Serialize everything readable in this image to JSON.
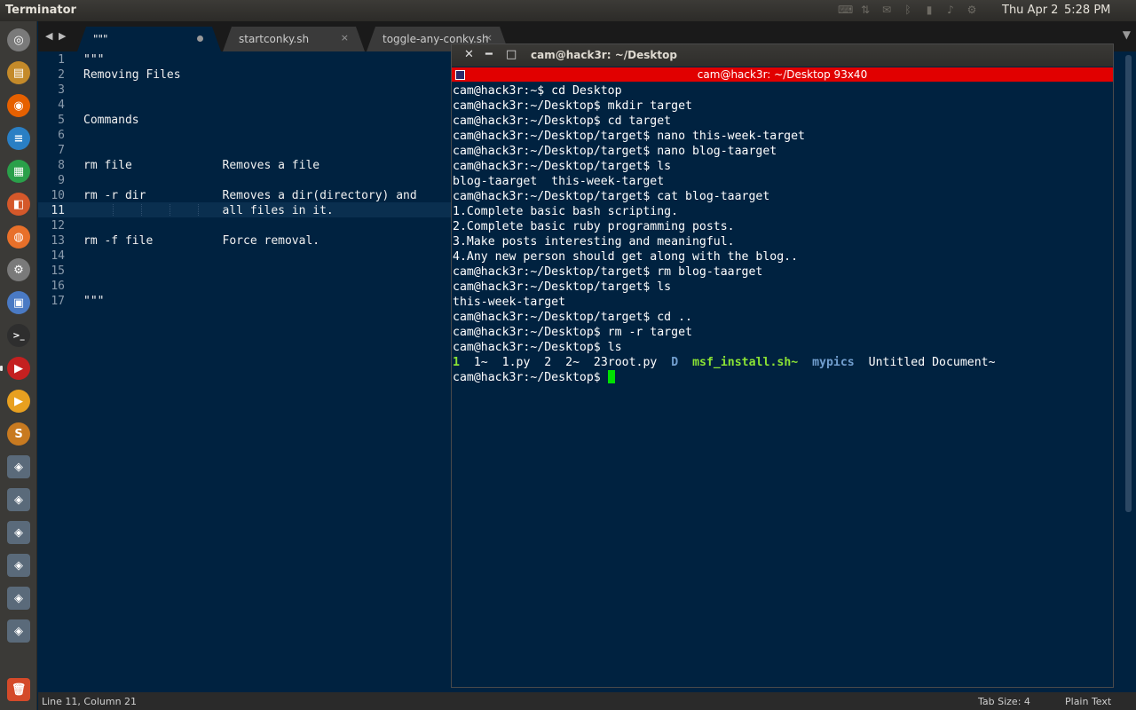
{
  "top_panel": {
    "app_title": "Terminator",
    "date": "Thu Apr  2",
    "time": "5:28 PM",
    "indicators": [
      "keyboard-icon",
      "network-icon",
      "mail-icon",
      "bluetooth-icon",
      "battery-icon",
      "volume-icon",
      "settings-icon"
    ]
  },
  "launcher": {
    "items": [
      {
        "name": "dash-icon",
        "color": "#7a7a7a"
      },
      {
        "name": "files-icon",
        "color": "#c48a2a"
      },
      {
        "name": "firefox-icon",
        "color": "#e66000"
      },
      {
        "name": "writer-icon",
        "color": "#2a7fc4"
      },
      {
        "name": "calc-icon",
        "color": "#2aa04a"
      },
      {
        "name": "impress-icon",
        "color": "#d4582a"
      },
      {
        "name": "software-center-icon",
        "color": "#e8702a"
      },
      {
        "name": "settings-icon",
        "color": "#7a7a7a"
      },
      {
        "name": "workspace-icon",
        "color": "#4a7ac4"
      },
      {
        "name": "terminal-icon",
        "color": "#2e2e2e"
      },
      {
        "name": "terminator-icon",
        "color": "#c42020"
      },
      {
        "name": "media-player-icon",
        "color": "#e8a020"
      },
      {
        "name": "sublime-icon",
        "color": "#c87a20"
      },
      {
        "name": "disk-icon",
        "color": "#5a6a7a"
      },
      {
        "name": "disk-icon",
        "color": "#5a6a7a"
      },
      {
        "name": "disk-icon",
        "color": "#5a6a7a"
      },
      {
        "name": "disk-icon",
        "color": "#5a6a7a"
      },
      {
        "name": "disk-icon",
        "color": "#5a6a7a"
      },
      {
        "name": "disk-icon",
        "color": "#5a6a7a"
      },
      {
        "name": "trash-icon",
        "color": "#d44a2a"
      }
    ]
  },
  "editor": {
    "tabs": [
      {
        "label": "\"\"\"",
        "modified": true
      },
      {
        "label": "startconky.sh",
        "close": "×"
      },
      {
        "label": "toggle-any-conky.sh",
        "close": "×"
      }
    ],
    "lines": [
      {
        "n": "1",
        "text": "\"\"\""
      },
      {
        "n": "2",
        "text": "Removing Files"
      },
      {
        "n": "3",
        "text": ""
      },
      {
        "n": "4",
        "text": ""
      },
      {
        "n": "5",
        "text": "Commands"
      },
      {
        "n": "6",
        "text": ""
      },
      {
        "n": "7",
        "text": ""
      },
      {
        "n": "8",
        "text": "rm file             Removes a file"
      },
      {
        "n": "9",
        "text": ""
      },
      {
        "n": "10",
        "text": "rm -r dir           Removes a dir(directory) and"
      },
      {
        "n": "11",
        "text": "                    all files in it."
      },
      {
        "n": "12",
        "text": ""
      },
      {
        "n": "13",
        "text": "rm -f file          Force removal."
      },
      {
        "n": "14",
        "text": ""
      },
      {
        "n": "15",
        "text": ""
      },
      {
        "n": "16",
        "text": ""
      },
      {
        "n": "17",
        "text": "\"\"\""
      }
    ],
    "status": {
      "position": "Line 11, Column 21",
      "tab_size": "Tab Size: 4",
      "syntax": "Plain Text"
    }
  },
  "terminal": {
    "window_title": "cam@hack3r: ~/Desktop",
    "header_title": "cam@hack3r: ~/Desktop 93x40",
    "lines": [
      "cam@hack3r:~$ cd Desktop",
      "cam@hack3r:~/Desktop$ mkdir target",
      "cam@hack3r:~/Desktop$ cd target",
      "cam@hack3r:~/Desktop/target$ nano this-week-target",
      "cam@hack3r:~/Desktop/target$ nano blog-taarget",
      "cam@hack3r:~/Desktop/target$ ls",
      "blog-taarget  this-week-target",
      "cam@hack3r:~/Desktop/target$ cat blog-taarget",
      "1.Complete basic bash scripting.",
      "2.Complete basic ruby programming posts.",
      "3.Make posts interesting and meaningful.",
      "4.Any new person should get along with the blog..",
      "cam@hack3r:~/Desktop/target$ rm blog-taarget",
      "cam@hack3r:~/Desktop/target$ ls",
      "this-week-target",
      "cam@hack3r:~/Desktop/target$ cd ..",
      "cam@hack3r:~/Desktop$ rm -r target",
      "cam@hack3r:~/Desktop$ ls"
    ],
    "ls_output": [
      {
        "text": "1",
        "type": "exec"
      },
      {
        "text": "1~",
        "type": "file"
      },
      {
        "text": "1.py",
        "type": "file"
      },
      {
        "text": "2",
        "type": "file"
      },
      {
        "text": "2~",
        "type": "file"
      },
      {
        "text": "23root.py",
        "type": "file"
      },
      {
        "text": "D",
        "type": "dir"
      },
      {
        "text": "msf_install.sh~",
        "type": "exec"
      },
      {
        "text": "mypics",
        "type": "dir"
      },
      {
        "text": "Untitled Document~",
        "type": "file"
      }
    ],
    "prompt": "cam@hack3r:~/Desktop$ "
  }
}
